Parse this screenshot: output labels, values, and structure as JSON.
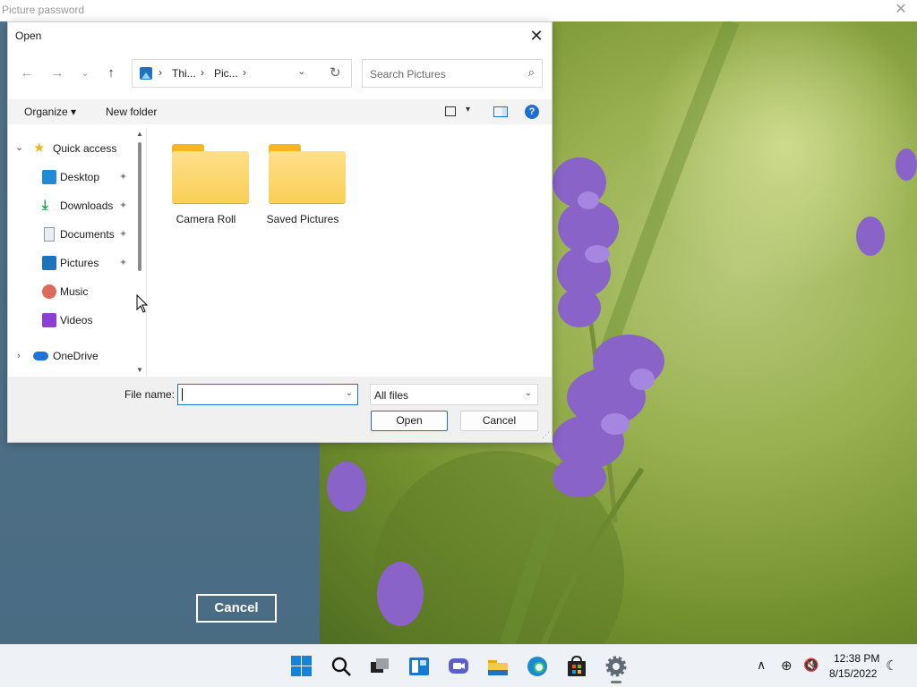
{
  "app": {
    "title": "Picture password",
    "close_glyph": "✕",
    "cancel_label": "Cancel"
  },
  "dialog": {
    "title": "Open",
    "close_glyph": "✕",
    "nav": {
      "back": "←",
      "forward": "→",
      "recent": "⌄",
      "up": "↑"
    },
    "address": {
      "segments": [
        "Thi...",
        "Pic..."
      ],
      "separator": "›",
      "dropdown": "⌄",
      "refresh": "↻"
    },
    "search": {
      "placeholder": "Search Pictures",
      "icon": "⌕"
    },
    "toolbar": {
      "organize": "Organize ▾",
      "new_folder": "New folder",
      "view_drop": "▾",
      "help": "?"
    },
    "nav_pane": {
      "quick_access": "Quick access",
      "items": [
        {
          "label": "Desktop",
          "icon": "desktop-icon",
          "pinned": true
        },
        {
          "label": "Downloads",
          "icon": "downloads-icon",
          "pinned": true
        },
        {
          "label": "Documents",
          "icon": "documents-icon",
          "pinned": true
        },
        {
          "label": "Pictures",
          "icon": "pictures-icon",
          "pinned": true
        },
        {
          "label": "Music",
          "icon": "music-icon",
          "pinned": false
        },
        {
          "label": "Videos",
          "icon": "videos-icon",
          "pinned": false
        }
      ],
      "onedrive": "OneDrive",
      "pin_glyph": "📌",
      "expand_open": "⌄",
      "expand_closed": "›",
      "scroll_up": "▲",
      "scroll_down": "▼"
    },
    "folders": [
      "Camera Roll",
      "Saved Pictures"
    ],
    "file_name_label": "File name:",
    "file_name_value": "",
    "file_type": "All files",
    "dropdown_glyph": "⌄",
    "open_label": "Open",
    "cancel_label": "Cancel"
  },
  "taskbar": {
    "time": "12:38 PM",
    "date": "8/15/2022",
    "tray_chevron": "∧",
    "network_glyph": "⊕",
    "volume_glyph": "🔇",
    "focus_glyph": "☾"
  },
  "colors": {
    "accent": "#1e6fd0",
    "folder": "#f9cf57",
    "left_panel": "#4f7088",
    "taskbar": "#eef1f5"
  }
}
